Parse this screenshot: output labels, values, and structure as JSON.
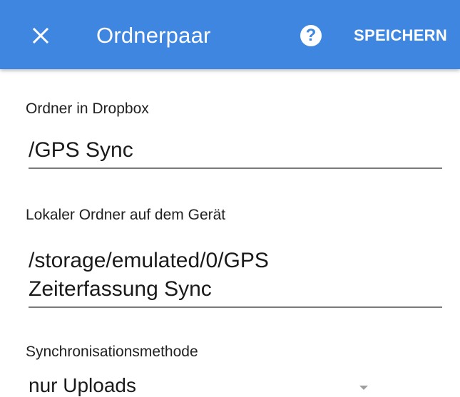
{
  "appbar": {
    "title": "Ordnerpaar",
    "close_icon": "close-icon",
    "help_icon": "help-icon",
    "help_glyph": "?",
    "save_label": "SPEICHERN",
    "background_color": "#3f86e0"
  },
  "form": {
    "dropbox_folder": {
      "label": "Ordner in Dropbox",
      "value": "/GPS Sync"
    },
    "local_folder": {
      "label": "Lokaler Ordner auf dem Gerät",
      "value_line1": "/storage/emulated/0/GPS",
      "value_line2": "Zeiterfassung Sync"
    },
    "sync_method": {
      "label": "Synchronisationsmethode",
      "selected": "nur Uploads",
      "dropdown_icon": "dropdown-arrow-icon"
    }
  }
}
